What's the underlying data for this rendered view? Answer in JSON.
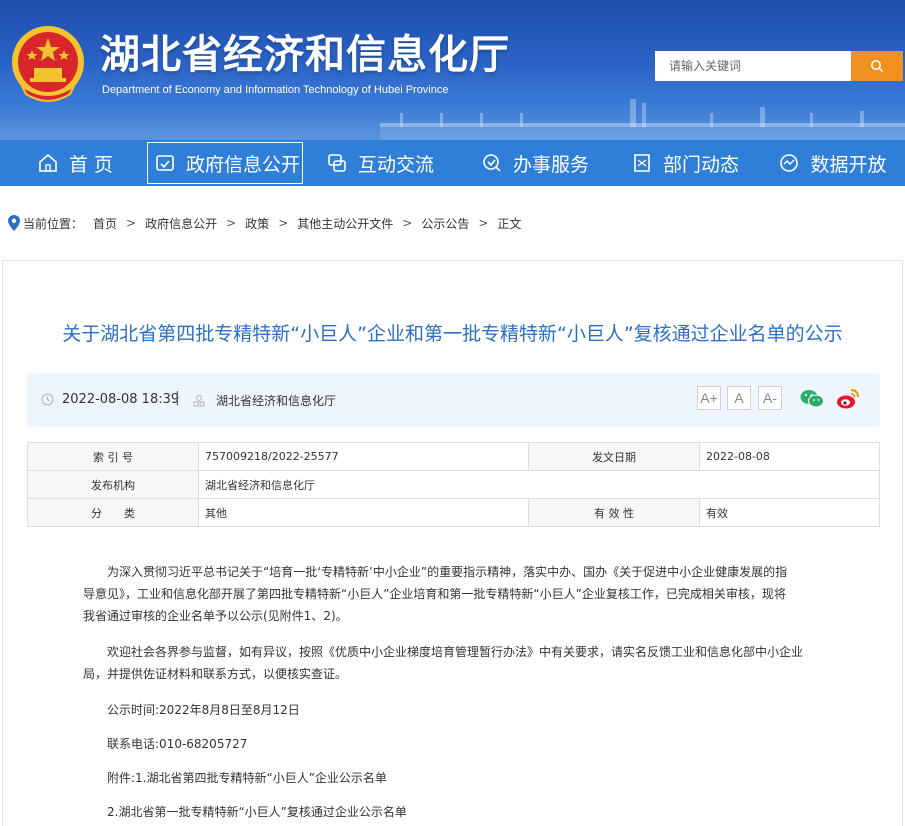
{
  "header": {
    "title": "湖北省经济和信息化厅",
    "subtitle": "Department of Economy and Information Technology of Hubei Province",
    "search_placeholder": "请输入关键词"
  },
  "nav": {
    "items": [
      {
        "label": "首 页",
        "icon": "home-icon"
      },
      {
        "label": "政府信息公开",
        "icon": "disclosure-icon",
        "active": true
      },
      {
        "label": "互动交流",
        "icon": "interaction-icon"
      },
      {
        "label": "办事服务",
        "icon": "service-icon"
      },
      {
        "label": "部门动态",
        "icon": "news-icon"
      },
      {
        "label": "数据开放",
        "icon": "data-icon"
      }
    ]
  },
  "breadcrumb": {
    "prefix": "当前位置：",
    "items": [
      "首页",
      "政府信息公开",
      "政策",
      "其他主动公开文件",
      "公示公告",
      "正文"
    ]
  },
  "article": {
    "title": "关于湖北省第四批专精特新“小巨人”企业和第一批专精特新“小巨人”复核通过企业名单的公示",
    "date": "2022-08-08 18:39",
    "source": "湖北省经济和信息化厅",
    "font_buttons": [
      "A+",
      "A",
      "A-"
    ],
    "info": {
      "index_label": "索 引 号",
      "index_value": "757009218/2022-25577",
      "issue_date_label": "发文日期",
      "issue_date_value": "2022-08-08",
      "publisher_label": "发布机构",
      "publisher_value": "湖北省经济和信息化厅",
      "category_label": "分　　类",
      "category_value": "其他",
      "validity_label": "有 效 性",
      "validity_value": "有效"
    },
    "paragraphs": {
      "p1_l1": "为深入贯彻习近平总书记关于“培育一批‘专精特新’中小企业”的重要指示精神，落实中办、国办《关于促进中小企业健康发展的指",
      "p1_l2": "导意见》，工业和信息化部开展了第四批专精特新“小巨人”企业培育和第一批专精特新“小巨人”企业复核工作，已完成相关审核，现将",
      "p1_l3": "我省通过审核的企业名单予以公示(见附件1、2)。",
      "p2_l1": "欢迎社会各界参与监督，如有异议，按照《优质中小企业梯度培育管理暂行办法》中有关要求，请实名反馈工业和信息化部中小企业",
      "p2_l2": "局，并提供佐证材料和联系方式，以便核实查证。",
      "p3": "公示时间:2022年8月8日至8月12日",
      "p4": "联系电话:010-68205727",
      "p5": "附件:1.湖北省第四批专精特新“小巨人”企业公示名单",
      "p6": "2.湖北省第一批专精特新“小巨人”复核通过企业公示名单"
    }
  }
}
